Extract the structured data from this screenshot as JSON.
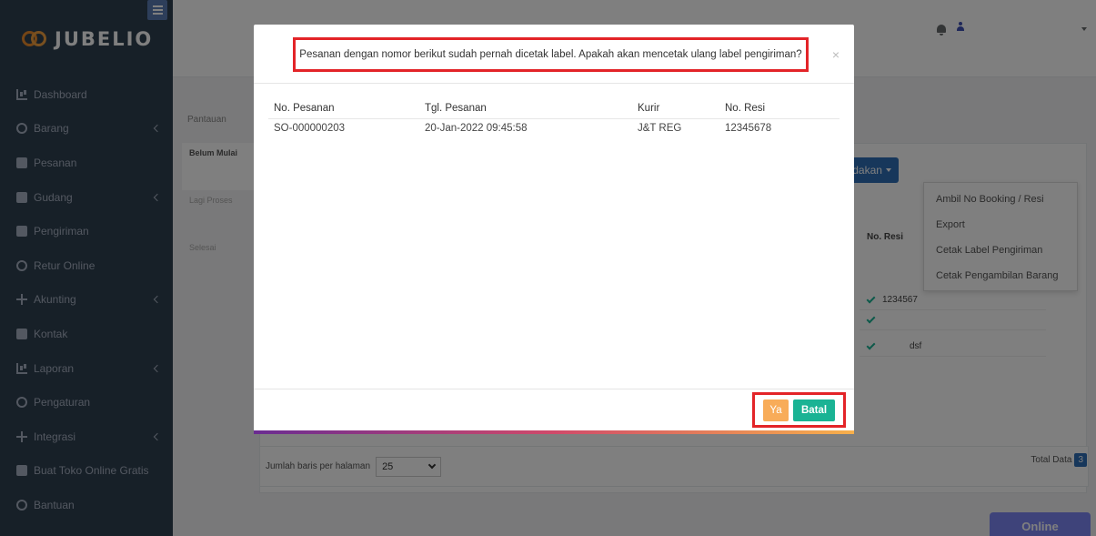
{
  "brand": {
    "name": "JUBELIO"
  },
  "sidebar": {
    "items": [
      {
        "label": "Dashboard",
        "icon": "dashboard-icon"
      },
      {
        "label": "Barang",
        "icon": "barang-icon",
        "has_children": true
      },
      {
        "label": "Pesanan",
        "icon": "pesanan-icon"
      },
      {
        "label": "Gudang",
        "icon": "gudang-icon",
        "has_children": true
      },
      {
        "label": "Pengiriman",
        "icon": "truck-icon"
      },
      {
        "label": "Retur Online",
        "icon": "return-icon"
      },
      {
        "label": "Akunting",
        "icon": "akunting-icon",
        "has_children": true
      },
      {
        "label": "Kontak",
        "icon": "contact-card-icon"
      },
      {
        "label": "Laporan",
        "icon": "line-chart-icon",
        "has_children": true
      },
      {
        "label": "Pengaturan",
        "icon": "gears-icon"
      },
      {
        "label": "Integrasi",
        "icon": "integrasi-icon",
        "has_children": true
      },
      {
        "label": "Buat Toko Online Gratis",
        "icon": "cart-icon"
      },
      {
        "label": "Bantuan",
        "icon": "help-icon"
      }
    ]
  },
  "main": {
    "tab": "Pantauan",
    "subnav": [
      {
        "label": "Belum Mulai",
        "active": true
      },
      {
        "label": "Lagi Proses",
        "active": false
      },
      {
        "label": "Selesai",
        "active": false
      }
    ],
    "tindakan_label": "Tindakan",
    "tindakan_menu": [
      "Ambil No Booking / Resi",
      "Export",
      "Cetak Label Pengiriman",
      "Cetak Pengambilan Barang"
    ],
    "bg_table": {
      "no_resi_header": "No. Resi",
      "rows": [
        {
          "resi": "1234567"
        },
        {
          "resi": ""
        },
        {
          "resi": "dsf"
        }
      ]
    },
    "footer": {
      "rows_per_page_label": "Jumlah baris per halaman",
      "rows_per_page_value": "25",
      "total_label": "Total Data",
      "total_value": "3"
    },
    "online_label": "Online"
  },
  "modal": {
    "message": "Pesanan dengan nomor berikut sudah pernah dicetak label. Apakah akan mencetak ulang label pengiriman?",
    "close_symbol": "×",
    "columns": [
      "No. Pesanan",
      "Tgl. Pesanan",
      "Kurir",
      "No. Resi"
    ],
    "rows": [
      {
        "no_pesanan": "SO-000000203",
        "tgl_pesanan": "20-Jan-2022 09:45:58",
        "kurir": "J&T REG",
        "no_resi": "12345678"
      }
    ],
    "btn_yes": "Ya",
    "btn_cancel": "Batal"
  },
  "colors": {
    "sidebar_bg": "#2f4050",
    "highlight_red": "#e32428",
    "btn_yes": "#f8ac59",
    "btn_cancel": "#1ab394",
    "primary_blue": "#2e6fb7",
    "online_purple": "#7c86f4"
  }
}
